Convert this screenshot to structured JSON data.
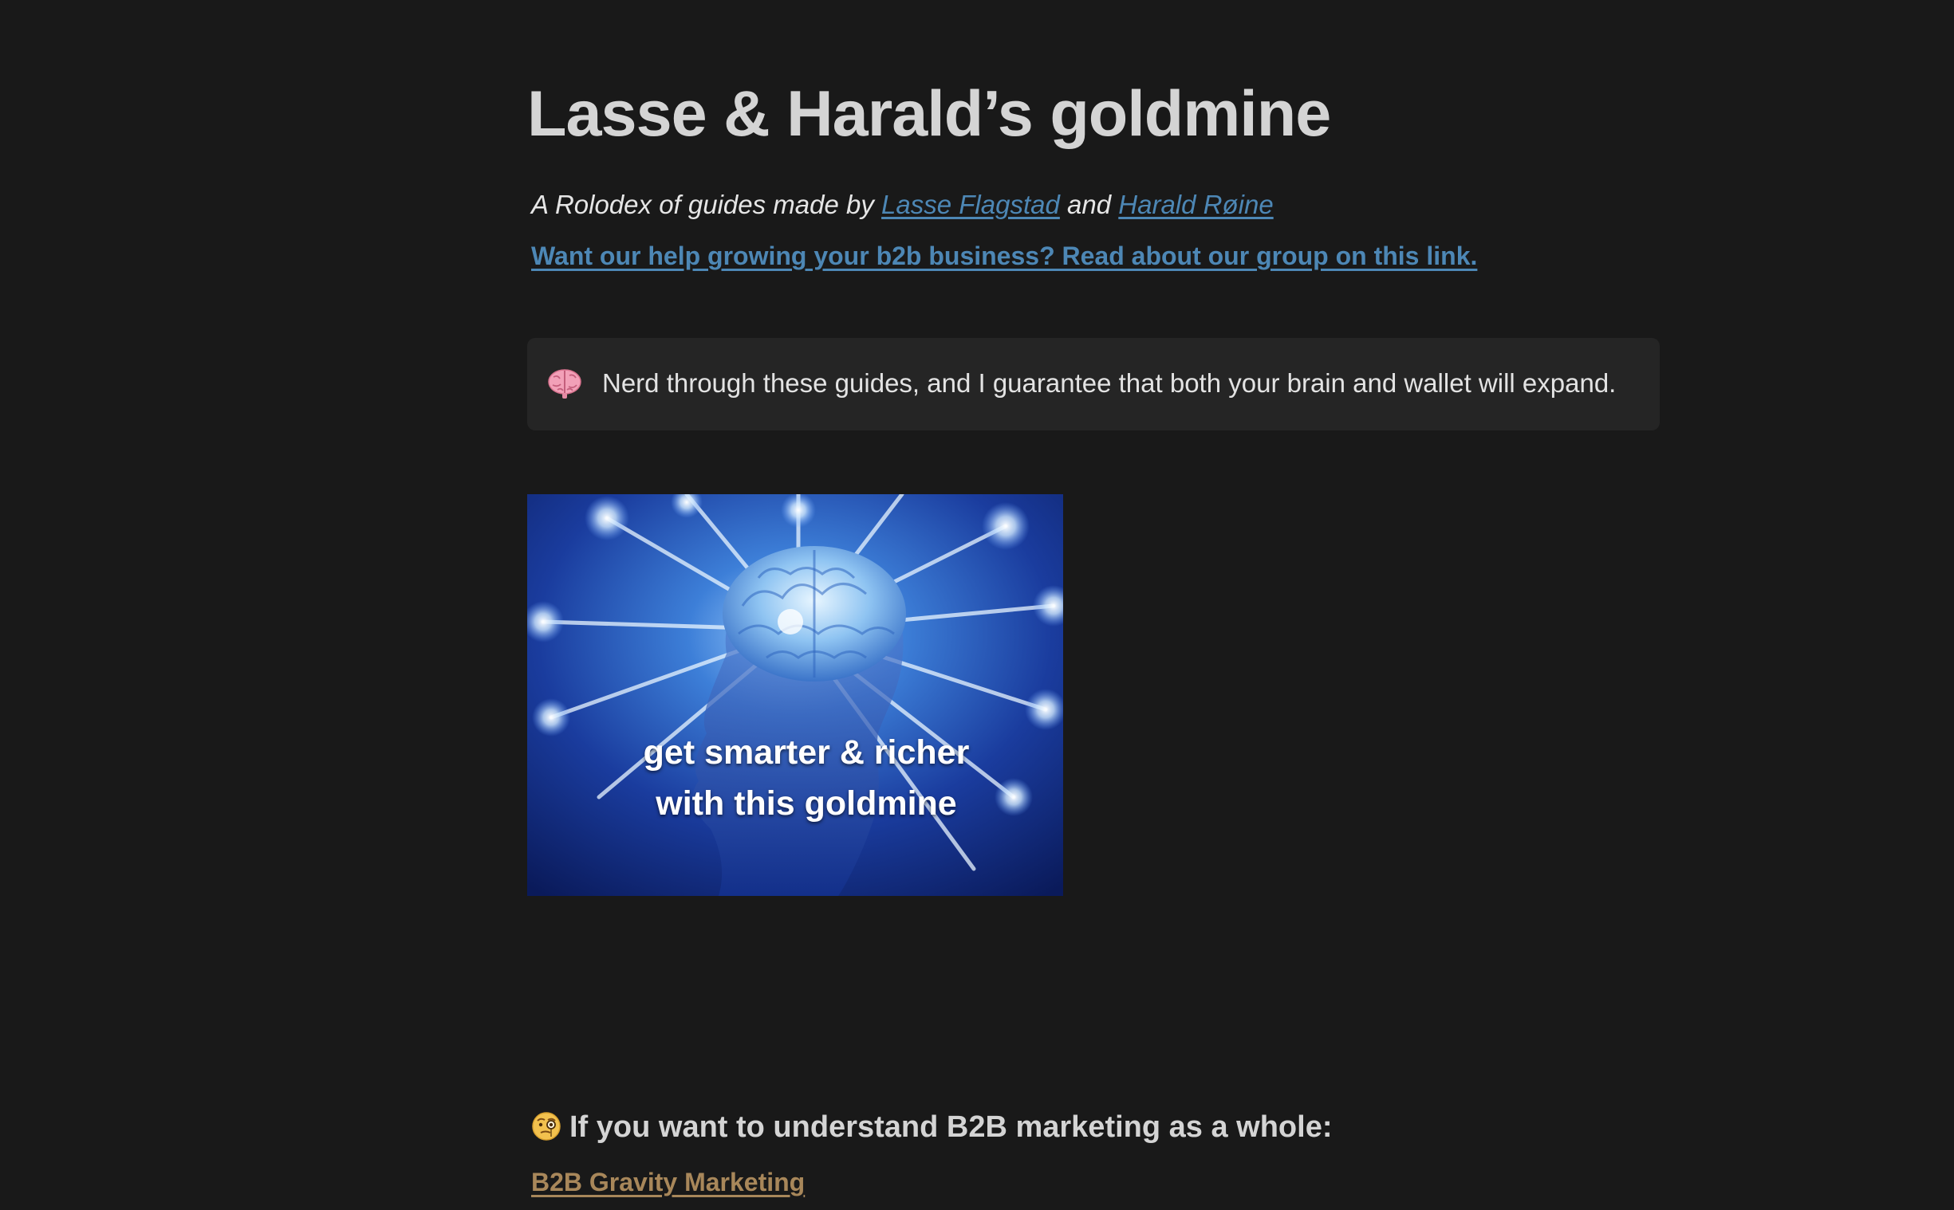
{
  "page": {
    "title": "Lasse & Harald’s goldmine",
    "subtitle_prefix": "A Rolodex of guides made by ",
    "author1": "Lasse Flagstad",
    "subtitle_and": " and ",
    "author2": "Harald Røine",
    "cta_link": "Want our help growing your b2b business? Read about our group on this link."
  },
  "callout": {
    "icon": "brain-emoji",
    "text": "Nerd through these guides, and I guarantee that both your brain and wallet will expand."
  },
  "hero_image": {
    "caption_line1": "get smarter & richer",
    "caption_line2": "with this goldmine"
  },
  "section": {
    "icon": "monocle-face-emoji",
    "heading": "If you want to understand B2B marketing as a whole:",
    "link": "B2B Gravity Marketing"
  },
  "colors": {
    "background": "#191919",
    "link_blue": "#4d87b5",
    "link_gold": "#a8875a",
    "callout_bg": "#252525"
  }
}
